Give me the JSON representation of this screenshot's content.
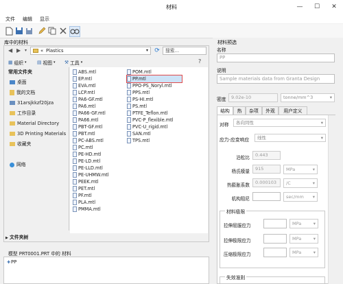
{
  "window": {
    "title": "材料",
    "minimize_glyph": "—",
    "maximize_glyph": "☐",
    "close_glyph": "✕"
  },
  "menu": [
    "文件",
    "编辑",
    "显示"
  ],
  "library": {
    "section_label": "库中的材料",
    "path_prefix": "«",
    "path": "Plastics",
    "search_placeholder": "搜索...",
    "organize_label": "组织",
    "view_label": "视图",
    "tools_label": "工具",
    "favorites_header": "常用文件夹",
    "sidebar": [
      "桌面",
      "我的文档",
      "31arsjkkzf20jza",
      "工作目录",
      "Material Directory",
      "3D Printing Materials",
      "收藏夹",
      "网络"
    ],
    "folder_tree_label": "文件夹树",
    "files_col1": [
      "ABS.mtl",
      "EP.mtl",
      "EVA.mtl",
      "LCP.mtl",
      "PA6-GF.mtl",
      "PA6.mtl",
      "PA66-GF.mtl",
      "PA66.mtl",
      "PBT-GF.mtl",
      "PBT.mtl",
      "PC-ABS.mtl",
      "PC.mtl",
      "PE-HD.mtl",
      "PE-LD.mtl",
      "PE-LLD.mtl",
      "PE-UHMW.mtl",
      "PEEK.mtl",
      "PET.mtl",
      "PF.mtl",
      "PLA.mtl",
      "PMMA.mtl"
    ],
    "files_col2": [
      "POM.mtl",
      "PP.mtl",
      "PPO-PS_Noryl.mtl",
      "PPS.mtl",
      "PS-HI.mtl",
      "PS.mtl",
      "PTFE_Teflon.mtl",
      "PVC-P_flexible.mtl",
      "PVC-U_rigid.mtl",
      "SAN.mtl",
      "TPS.mtl"
    ],
    "selected_file": "PP.mtl"
  },
  "model": {
    "section_label": "模型 PRT0001.PRT 中的 材料",
    "items": [
      "PP"
    ]
  },
  "preview": {
    "section_label": "材料预选",
    "name_label": "名称",
    "name_value": "PP",
    "desc_label": "说明",
    "desc_value": "Sample materials data from Granta Design",
    "density_label": "密度",
    "density_value": "9.02e-10",
    "density_unit": "tonne/mm^3",
    "tabs": [
      "结构",
      "热",
      "杂项",
      "外观",
      "用户定义"
    ],
    "active_tab": "结构",
    "symmetry_label": "对称",
    "symmetry_value": "各向同性",
    "stress_strain_label": "应力-应变响应",
    "stress_strain_value": "线性",
    "props": [
      {
        "label": "泊松比",
        "value": "0.443",
        "unit": ""
      },
      {
        "label": "杨氏模量",
        "value": "915",
        "unit": "MPa"
      },
      {
        "label": "热膨胀系数",
        "value": "0.000103",
        "unit": "/C"
      },
      {
        "label": "机构阻尼",
        "value": "",
        "unit": "sec/mm"
      }
    ],
    "limits_label": "材料极限",
    "limits": [
      {
        "label": "拉伸屈服应力",
        "unit": "MPa"
      },
      {
        "label": "拉伸极限应力",
        "unit": "MPa"
      },
      {
        "label": "压缩极限应力",
        "unit": "MPa"
      }
    ],
    "failure_label": "失效准则"
  }
}
